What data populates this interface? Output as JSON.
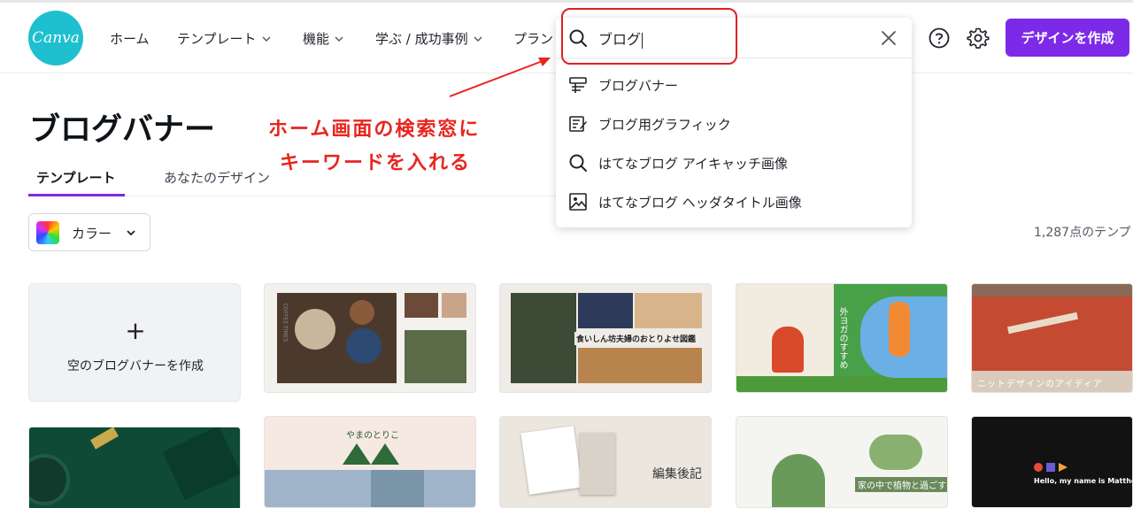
{
  "header": {
    "logo_text": "Canva",
    "nav": [
      {
        "label": "ホーム",
        "dropdown": false
      },
      {
        "label": "テンプレート",
        "dropdown": true
      },
      {
        "label": "機能",
        "dropdown": true
      },
      {
        "label": "学ぶ / 成功事例",
        "dropdown": true
      },
      {
        "label": "プラン",
        "dropdown": false
      }
    ],
    "help_icon": "help-circle-icon",
    "settings_icon": "gear-icon",
    "create_button": "デザインを作成"
  },
  "search": {
    "value": "ブログ",
    "icon": "search-icon",
    "clear_icon": "close-icon",
    "suggestions": [
      {
        "icon": "blog-banner-icon",
        "label": "ブログバナー"
      },
      {
        "icon": "blog-graphic-icon",
        "label": "ブログ用グラフィック"
      },
      {
        "icon": "search-icon",
        "label": "はてなブログ アイキャッチ画像"
      },
      {
        "icon": "image-icon",
        "label": "はてなブログ ヘッダタイトル画像"
      }
    ]
  },
  "annotation": {
    "lines": [
      "ホーム画面の検索窓に",
      "キーワードを入れる"
    ],
    "color": "#e8251f"
  },
  "page": {
    "title": "ブログバナー",
    "tabs": [
      {
        "label": "テンプレート",
        "active": true
      },
      {
        "label": "あなたのデザイン",
        "active": false
      }
    ],
    "color_filter": "カラー",
    "count_text": "1,287点のテンプ",
    "blank_card": {
      "plus": "+",
      "label": "空のブログバナーを作成"
    }
  },
  "templates": {
    "row1": [
      {
        "name": "coffee-table",
        "text": "COFFEE TIMES"
      },
      {
        "name": "food-collage",
        "text": "食いしん坊夫婦のおとりよせ図鑑"
      },
      {
        "name": "yoga",
        "text": "外ヨガのすすめ"
      },
      {
        "name": "knit-design",
        "text": "ニットデザインのアイディア"
      }
    ],
    "row2": [
      {
        "name": "green-desk",
        "text": ""
      },
      {
        "name": "mountain",
        "text": "やまのとりこ"
      },
      {
        "name": "editor-journal",
        "text": "編集後記"
      },
      {
        "name": "plants",
        "text": "家の中で植物と過ごす"
      },
      {
        "name": "hello",
        "text": "Hello, my name is Matthew."
      }
    ]
  },
  "colors": {
    "accent": "#7d2ae8",
    "logo": "#1ec0cf",
    "highlight": "#e02020"
  }
}
